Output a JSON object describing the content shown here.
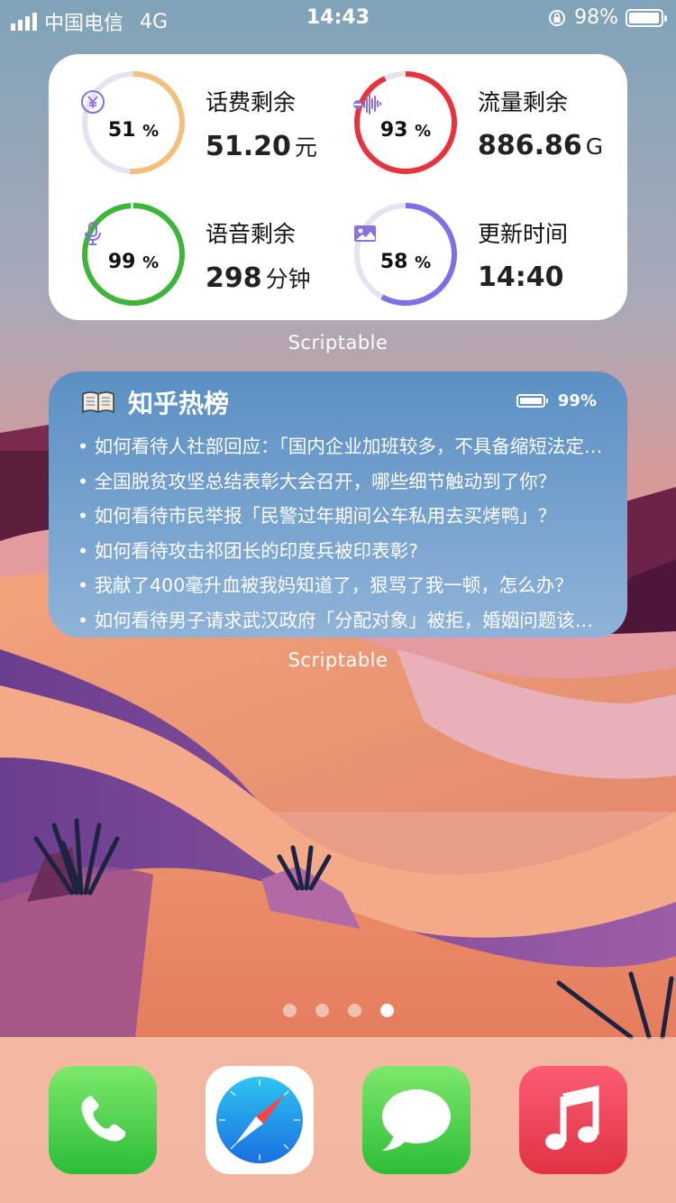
{
  "status_bar": {
    "carrier": "中国电信",
    "network": "4G",
    "time": "14:43",
    "battery": "98%",
    "battery_level": 0.98
  },
  "data_widget": {
    "caption": "Scriptable",
    "items": [
      {
        "label": "话费剩余",
        "value": "51.20",
        "unit": "元",
        "percent": "51",
        "percent_sign": "%",
        "fraction": 0.51,
        "icon": "yen-icon",
        "color": "#f3c07c"
      },
      {
        "label": "流量剩余",
        "value": "886.86",
        "unit": "G",
        "percent": "93",
        "percent_sign": "%",
        "fraction": 0.93,
        "icon": "waveform-icon",
        "color": "#e8333c"
      },
      {
        "label": "语音剩余",
        "value": "298",
        "unit": "分钟",
        "percent": "99",
        "percent_sign": "%",
        "fraction": 0.99,
        "icon": "microphone-icon",
        "color": "#3db43a"
      },
      {
        "label": "更新时间",
        "value": "14:40",
        "unit": "",
        "percent": "58",
        "percent_sign": "%",
        "fraction": 0.58,
        "icon": "image-icon",
        "color": "#7d6fe6"
      }
    ],
    "icon_color": "#8a70e0"
  },
  "zhihu_widget": {
    "caption": "Scriptable",
    "icon": "book-icon",
    "title": "知乎热榜",
    "battery": "99%",
    "items": [
      "• 如何看待人社部回应：「国内企业加班较多，不具备缩短法定工作时间的条件」？",
      "• 全国脱贫攻坚总结表彰大会召开，哪些细节触动到了你？",
      "• 如何看待市民举报「民警过年期间公车私用去买烤鸭」？",
      "• 如何看待攻击祁团长的印度兵被印表彰?",
      "• 我献了400毫升血被我妈知道了，狠骂了我一顿，怎么办？",
      "• 如何看待男子请求武汉政府「分配对象」被拒，婚姻问题该由政府解决吗？"
    ]
  },
  "page_indicator": {
    "count": 4,
    "active": 4
  },
  "dock": {
    "apps": [
      {
        "name": "phone",
        "icon": "phone-icon"
      },
      {
        "name": "safari",
        "icon": "compass-icon"
      },
      {
        "name": "messages",
        "icon": "speech-bubble-icon"
      },
      {
        "name": "music",
        "icon": "music-note-icon"
      }
    ]
  }
}
